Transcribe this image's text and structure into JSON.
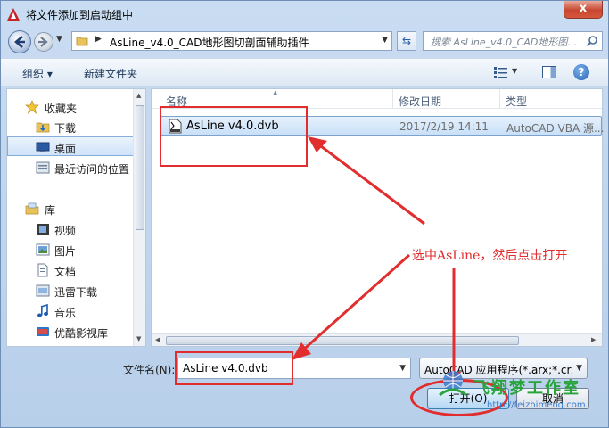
{
  "window": {
    "title": "将文件添加到启动组中",
    "close_label": "x"
  },
  "address": {
    "path": "AsLine_v4.0_CAD地形图切剖面辅助插件",
    "search_placeholder": "搜索 AsLine_v4.0_CAD地形图..."
  },
  "toolbar": {
    "organize_label": "组织 ▾",
    "new_folder_label": "新建文件夹",
    "help_label": "?"
  },
  "sidebar": {
    "items": [
      {
        "label": "收藏夹",
        "icon": "star-icon"
      },
      {
        "label": "下载",
        "icon": "download-folder-icon"
      },
      {
        "label": "桌面",
        "icon": "desktop-icon"
      },
      {
        "label": "最近访问的位置",
        "icon": "recent-places-icon"
      },
      {
        "label": "库",
        "icon": "library-icon"
      },
      {
        "label": "视频",
        "icon": "video-icon"
      },
      {
        "label": "图片",
        "icon": "picture-icon"
      },
      {
        "label": "文档",
        "icon": "document-icon"
      },
      {
        "label": "迅雷下载",
        "icon": "thunder-download-icon"
      },
      {
        "label": "音乐",
        "icon": "music-icon"
      },
      {
        "label": "优酷影视库",
        "icon": "youku-icon"
      }
    ]
  },
  "file_list": {
    "columns": [
      "名称",
      "修改日期",
      "类型"
    ],
    "rows": [
      {
        "name": "AsLine v4.0.dvb",
        "modified": "2017/2/19 14:11",
        "type": "AutoCAD VBA 源..."
      }
    ]
  },
  "bottom": {
    "filename_label": "文件名(N):",
    "filename_value": "AsLine v4.0.dvb",
    "filter_value": "AutoCAD 应用程序(*.arx;*.crx;",
    "open_label": "打开(O)",
    "cancel_label": "取消"
  },
  "annotation": {
    "text": "选中AsLine，然后点击打开",
    "color": "#e12d2d"
  },
  "watermark": {
    "name": "飞翔梦工作室",
    "url": "http://feizhimeng.com"
  }
}
